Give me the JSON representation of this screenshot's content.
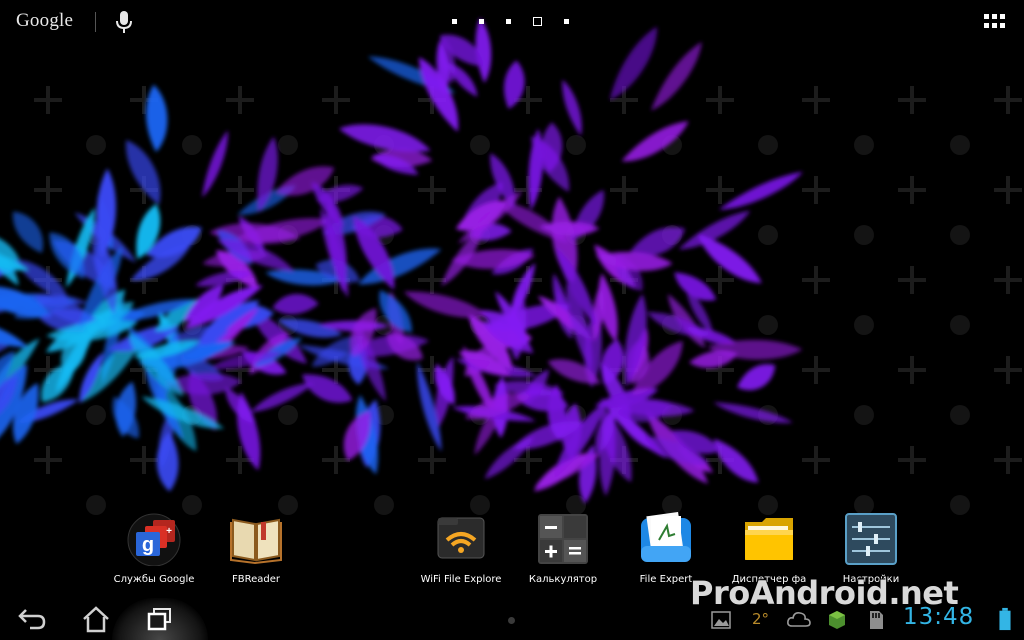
{
  "search": {
    "label": "Google"
  },
  "home_pages": {
    "count": 5,
    "active_index": 3
  },
  "dock_apps": [
    {
      "label": "Службы Google",
      "icon": "google-services-icon"
    },
    {
      "label": "FBReader",
      "icon": "book-icon"
    },
    {
      "label": "WiFi File Explore",
      "icon": "wifi-icon"
    },
    {
      "label": "Калькулятор",
      "icon": "calculator-icon"
    },
    {
      "label": "File Expert",
      "icon": "file-expert-icon"
    },
    {
      "label": "Диспетчер фа",
      "icon": "folder-icon"
    },
    {
      "label": "Настройки",
      "icon": "settings-sliders-icon"
    }
  ],
  "status": {
    "temperature": "2°",
    "time": "13:48"
  },
  "watermark": "ProAndroid.net",
  "colors": {
    "clock": "#33b5e5",
    "battery": "#33b5e5",
    "blob_purple": "#8a1cff",
    "blob_blue": "#1e6bff",
    "blob_cyan": "#17c4ff"
  }
}
